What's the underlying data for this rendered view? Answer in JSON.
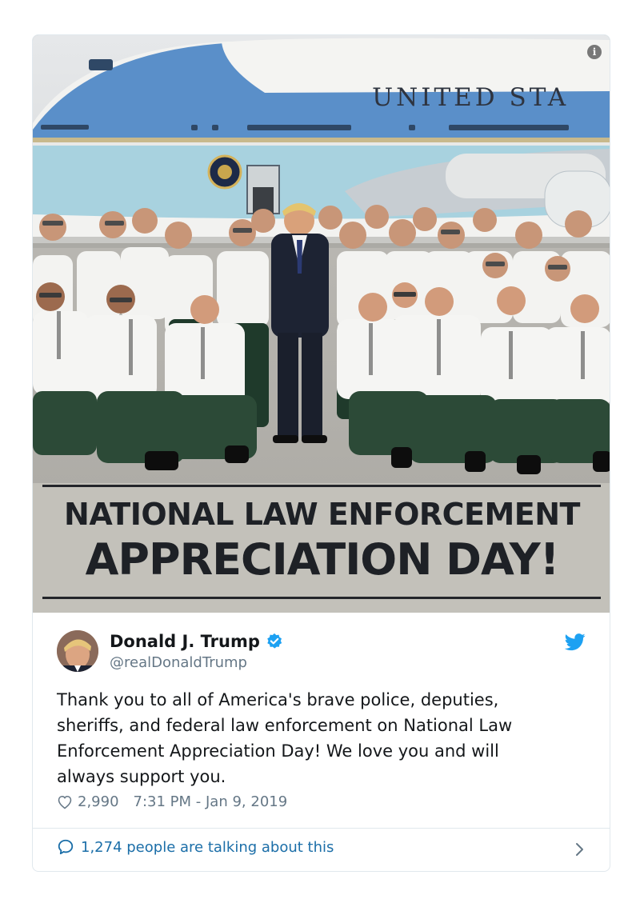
{
  "media": {
    "plane_lettering": "UNITED STA",
    "banner": {
      "line1": "NATIONAL LAW ENFORCEMENT",
      "line2": "APPRECIATION DAY!"
    },
    "info_icon": "info-icon"
  },
  "tweet": {
    "author_name": "Donald J. Trump",
    "handle": "@realDonaldTrump",
    "verified": true,
    "text_lines": [
      "Thank you to all of America's brave police, deputies,",
      "sheriffs, and federal law enforcement on National Law",
      "Enforcement Appreciation Day! We love you and will",
      "always support you."
    ],
    "likes": "2,990",
    "timestamp": "7:31 PM - Jan 9, 2019",
    "talking": "1,274 people are talking about this"
  },
  "colors": {
    "link_blue": "#1b6ea8",
    "twitter_blue": "#1da1f2",
    "muted_gray": "#657786",
    "text_dark": "#14171a"
  },
  "icons": [
    "info-icon",
    "verified-badge-icon",
    "twitter-bird-icon",
    "heart-icon",
    "speech-bubble-icon",
    "chevron-right-icon"
  ]
}
